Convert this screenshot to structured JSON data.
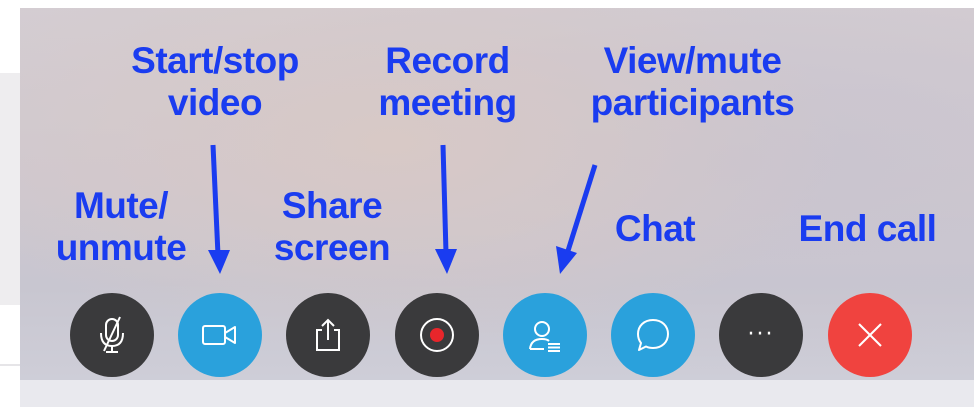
{
  "labels": {
    "mute": [
      "Mute/",
      "unmute"
    ],
    "video": [
      "Start/stop",
      "video"
    ],
    "share": [
      "Share",
      "screen"
    ],
    "record": [
      "Record",
      "meeting"
    ],
    "participants": [
      "View/mute",
      "participants"
    ],
    "chat": [
      "Chat"
    ],
    "end": [
      "End call"
    ]
  },
  "toolbar": {
    "buttons": [
      {
        "id": "mute",
        "icon": "mic-off-icon",
        "color": "#3a3a3c"
      },
      {
        "id": "video",
        "icon": "video-camera-icon",
        "color": "#2aa1dc"
      },
      {
        "id": "share",
        "icon": "share-upload-icon",
        "color": "#3a3a3c"
      },
      {
        "id": "record",
        "icon": "record-icon",
        "color": "#3a3a3c"
      },
      {
        "id": "participants",
        "icon": "participants-icon",
        "color": "#2aa1dc"
      },
      {
        "id": "chat",
        "icon": "chat-bubble-icon",
        "color": "#2aa1dc"
      },
      {
        "id": "more",
        "icon": "more-icon",
        "color": "#3a3a3c",
        "text": "···"
      },
      {
        "id": "end",
        "icon": "close-icon",
        "color": "#f0433f"
      }
    ]
  },
  "colors": {
    "annotation": "#1a3cf0",
    "record_dot": "#e8262b"
  }
}
